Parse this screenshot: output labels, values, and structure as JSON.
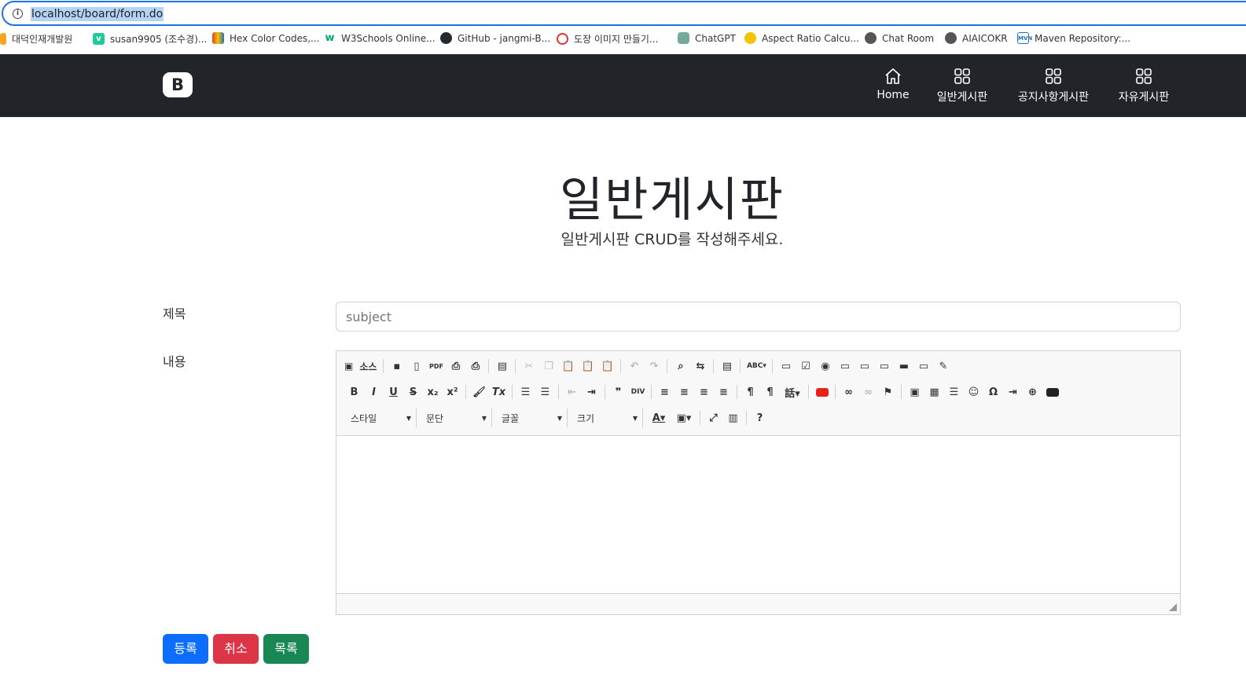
{
  "browser": {
    "url": "localhost/board/form.do",
    "bookmarks": [
      {
        "label": "대덕인재개발원",
        "icon": "pencil-icon",
        "color": "#f5a623"
      },
      {
        "label": "susan9905 (조수경)...",
        "icon": "velog-icon",
        "color": "#20c997"
      },
      {
        "label": "Hex Color Codes,...",
        "icon": "color-book-icon",
        "color": "#e0452b"
      },
      {
        "label": "W3Schools Online...",
        "icon": "w3schools-icon",
        "color": "#04aa6d"
      },
      {
        "label": "GitHub - jangmi-B...",
        "icon": "github-icon",
        "color": "#24292e"
      },
      {
        "label": "도장 이미지 만들기...",
        "icon": "stamp-icon",
        "color": "#d33"
      },
      {
        "label": "ChatGPT",
        "icon": "chatgpt-icon",
        "color": "#74aa9c"
      },
      {
        "label": "Aspect Ratio Calcu...",
        "icon": "aspect-ratio-icon",
        "color": "#f2c500"
      },
      {
        "label": "Chat Room",
        "icon": "globe-icon",
        "color": "#555"
      },
      {
        "label": "AIAICOKR",
        "icon": "globe-icon",
        "color": "#555"
      },
      {
        "label": "Maven Repository:...",
        "icon": "maven-icon",
        "color": "#1f6fbd"
      }
    ]
  },
  "navbar": {
    "brand": "B",
    "items": [
      {
        "label": "Home",
        "icon": "home-icon"
      },
      {
        "label": "일반게시판",
        "icon": "grid-icon"
      },
      {
        "label": "공지사항게시판",
        "icon": "grid-icon"
      },
      {
        "label": "자유게시판",
        "icon": "grid-icon"
      }
    ]
  },
  "page": {
    "title": "일반게시판",
    "subtitle": "일반게시판 CRUD를 작성해주세요."
  },
  "form": {
    "subject_label": "제목",
    "subject_placeholder": "subject",
    "content_label": "내용"
  },
  "editor": {
    "source_label": "소스",
    "combos": [
      "스타일",
      "문단",
      "글꼴",
      "크기"
    ]
  },
  "buttons": {
    "submit": "등록",
    "cancel": "취소",
    "list": "목록"
  },
  "colors": {
    "navbar_bg": "#212529",
    "primary": "#0d6efd",
    "danger": "#dc3545",
    "success": "#198754"
  }
}
